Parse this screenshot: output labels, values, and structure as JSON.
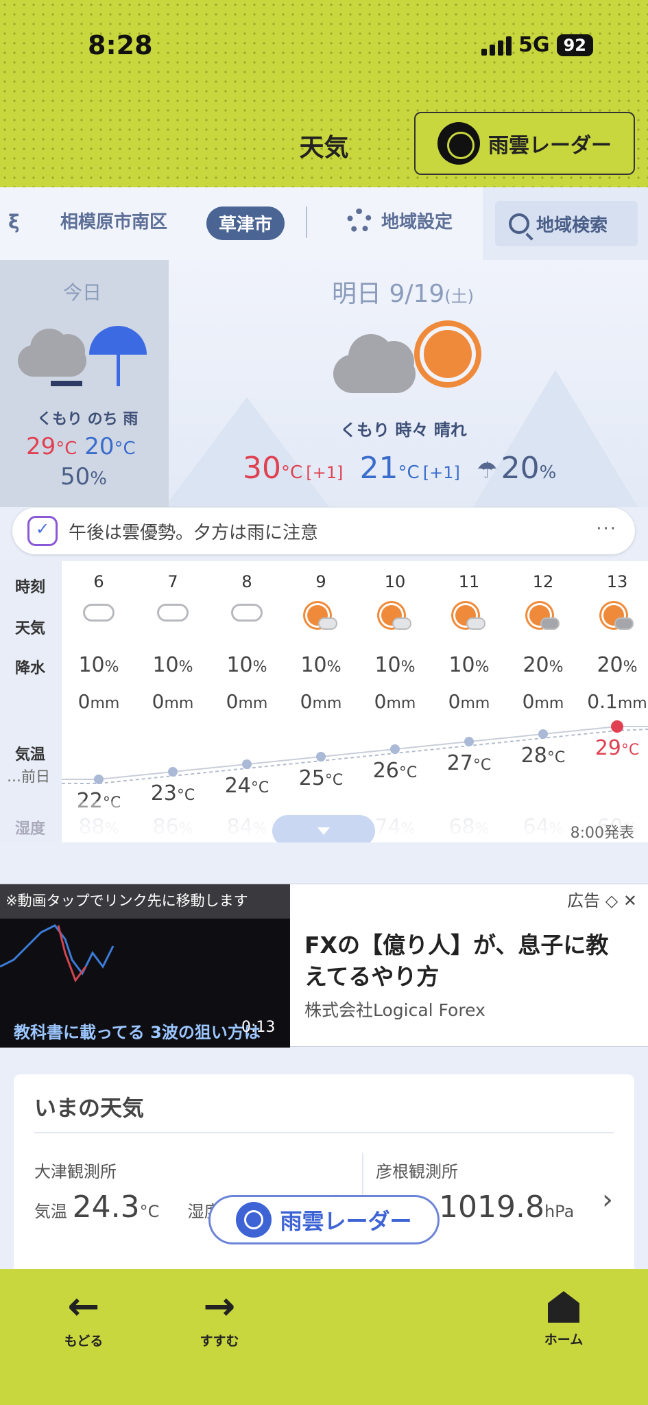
{
  "status": {
    "time": "8:28",
    "network": "5G",
    "battery": "92"
  },
  "header": {
    "title": "天気",
    "radar_button": "雨雲レーダー"
  },
  "area_bar": {
    "prev_glyph": "ξ",
    "items": [
      "相模原市南区",
      "草津市"
    ],
    "current": "草津市",
    "settings_label": "地域設定",
    "search_label": "地域検索"
  },
  "today": {
    "label": "今日",
    "weather": "くもり のち 雨",
    "high": "29",
    "low": "20",
    "unit": "°C",
    "precip": "50",
    "pct": "%"
  },
  "tomorrow": {
    "label": "明日 9/19",
    "dow": "(土)",
    "weather": "くもり 時々 晴れ",
    "high": "30",
    "high_diff": "[+1]",
    "low": "21",
    "low_diff": "[+1]",
    "unit": "°C",
    "precip": "20",
    "pct": "%"
  },
  "comment": {
    "text": "午後は雲優勢。夕方は雨に注意",
    "more": "···"
  },
  "hourly": {
    "labels": {
      "time": "時刻",
      "weather": "天気",
      "precip": "降水",
      "temp": "気温",
      "prev": "…前日",
      "humidity": "湿度"
    },
    "hours": [
      "6",
      "7",
      "8",
      "9",
      "10",
      "11",
      "12",
      "13"
    ],
    "weather_icons": [
      "cloud-icon",
      "cloud-icon",
      "cloud-icon",
      "sun-cloud-icon",
      "sun-cloud-icon",
      "sun-cloud-icon",
      "sun-cloud-icon",
      "sun-cloud-icon"
    ],
    "precip_pct": [
      "10",
      "10",
      "10",
      "10",
      "10",
      "10",
      "20",
      "20"
    ],
    "precip_mm": [
      "0",
      "0",
      "0",
      "0",
      "0",
      "0",
      "0",
      "0.1"
    ],
    "temps": [
      "22",
      "23",
      "24",
      "25",
      "26",
      "27",
      "28",
      "29"
    ],
    "humidity": [
      "88",
      "86",
      "84",
      "",
      "74",
      "68",
      "64",
      "60"
    ],
    "pct_unit": "%",
    "mm_unit": "mm",
    "temp_unit": "°C",
    "issued": "8:00発表"
  },
  "ad": {
    "video_notice": "※動画タップでリンク先に移動します",
    "video_caption": "教科書に載ってる 3波の狙い方は",
    "video_time": "0:13",
    "title": "FXの【億り人】が、息子に教えてるやり方",
    "company": "株式会社Logical Forex",
    "label": "広告"
  },
  "now": {
    "title": "いまの天気",
    "station1": {
      "name": "大津観測所",
      "temp_label": "気温",
      "temp": "24.3",
      "temp_unit": "°C",
      "hum_label": "湿度"
    },
    "station2": {
      "name": "彦根観測所",
      "pressure": "1019.8",
      "pressure_unit": "hPa"
    }
  },
  "float_radar": "雨雲レーダー",
  "bottom_nav": {
    "back": "もどる",
    "forward": "すすむ",
    "home": "ホーム"
  },
  "colors": {
    "header": "#c9d73f",
    "accent": "#4a6493",
    "hot": "#e04152",
    "cold": "#3a6ccc"
  }
}
